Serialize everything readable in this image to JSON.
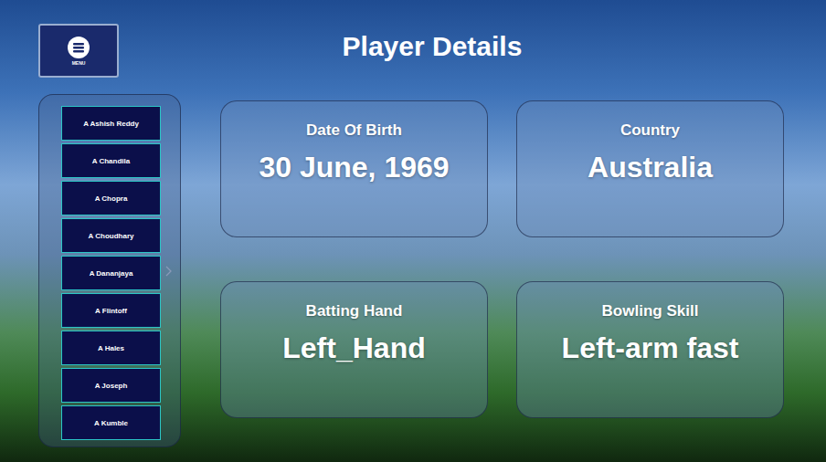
{
  "window": {
    "title": "Player Details"
  },
  "menu_button": {
    "label": "MENU"
  },
  "players": [
    {
      "name": "A Ashish Reddy",
      "selected": false
    },
    {
      "name": "A Chandila",
      "selected": false
    },
    {
      "name": "A Chopra",
      "selected": false
    },
    {
      "name": "A Choudhary",
      "selected": false
    },
    {
      "name": "A Dananjaya",
      "selected": false
    },
    {
      "name": "A Flintoff",
      "selected": false
    },
    {
      "name": "A Hales",
      "selected": false
    },
    {
      "name": "A Joseph",
      "selected": false
    },
    {
      "name": "A Kumble",
      "selected": false
    }
  ],
  "cards": [
    {
      "label": "Date Of Birth",
      "value": "30 June, 1969"
    },
    {
      "label": "Country",
      "value": "Australia"
    },
    {
      "label": "Batting Hand",
      "value": "Left_Hand"
    },
    {
      "label": "Bowling Skill",
      "value": "Left-arm fast"
    }
  ]
}
